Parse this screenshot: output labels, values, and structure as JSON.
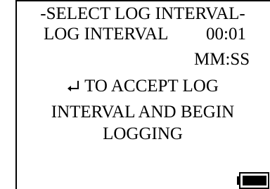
{
  "display": {
    "title": "-SELECT LOG INTERVAL-",
    "interval_label": "LOG INTERVAL",
    "interval_value": "00:01",
    "interval_units": "MM:SS",
    "instruction_line1": "TO ACCEPT LOG",
    "instruction_line2": "INTERVAL AND BEGIN",
    "instruction_line3": "LOGGING",
    "enter_icon": "enter-return-icon",
    "battery_icon": "battery-icon"
  }
}
